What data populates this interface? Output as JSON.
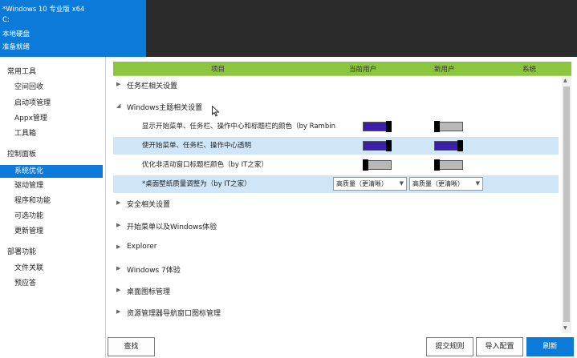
{
  "header": {
    "title": "*Windows 10 专业版 x64",
    "drive": "C:",
    "disk_type": "本地硬盘",
    "status": "准备就绪"
  },
  "sidebar": {
    "sections": [
      {
        "title": "常用工具",
        "items": [
          "空间回收",
          "启动项管理",
          "Appx管理",
          "工具箱"
        ]
      },
      {
        "title": "控制面板",
        "items": [
          "系统优化",
          "驱动管理",
          "程序和功能",
          "可选功能",
          "更新管理"
        ]
      },
      {
        "title": "部署功能",
        "items": [
          "文件关联",
          "预应答"
        ]
      }
    ],
    "selected": "系统优化"
  },
  "table": {
    "columns": [
      "项目",
      "当前用户",
      "新用户",
      "系统"
    ],
    "groups": [
      {
        "label": "任务栏相关设置",
        "expanded": false
      },
      {
        "label": "Windows主题相关设置",
        "expanded": true
      },
      {
        "label": "安全相关设置",
        "expanded": false
      },
      {
        "label": "开始菜单以及Windows体验",
        "expanded": false
      },
      {
        "label": "Explorer",
        "expanded": false
      },
      {
        "label": "Windows 7体验",
        "expanded": false
      },
      {
        "label": "桌面图标管理",
        "expanded": false
      },
      {
        "label": "资源管理器导航窗口图标管理",
        "expanded": false
      }
    ],
    "theme_items": [
      {
        "label": "显示开始菜单、任务栏、操作中心和标题栏的颜色（by Rambin",
        "current_user": "on",
        "new_user": "off"
      },
      {
        "label": "使开始菜单、任务栏、操作中心透明",
        "current_user": "on",
        "new_user": "on"
      },
      {
        "label": "优化非活动窗口标题栏颜色（by IT之家）",
        "current_user": "off",
        "new_user": "off"
      },
      {
        "label": "*桌面壁纸质量调整为（by IT之家）",
        "current_user_value": "高质量（更清晰）",
        "new_user_value": "高质量（更清晰）"
      }
    ]
  },
  "buttons": {
    "find": "查找",
    "submit_rule": "提交规则",
    "import_config": "导入配置",
    "refresh": "刷新"
  },
  "colors": {
    "accent": "#0b7ad9",
    "header_green": "#8cc63f",
    "toggle_on": "#3c1fa8",
    "row_highlight": "#cfe6f8"
  }
}
